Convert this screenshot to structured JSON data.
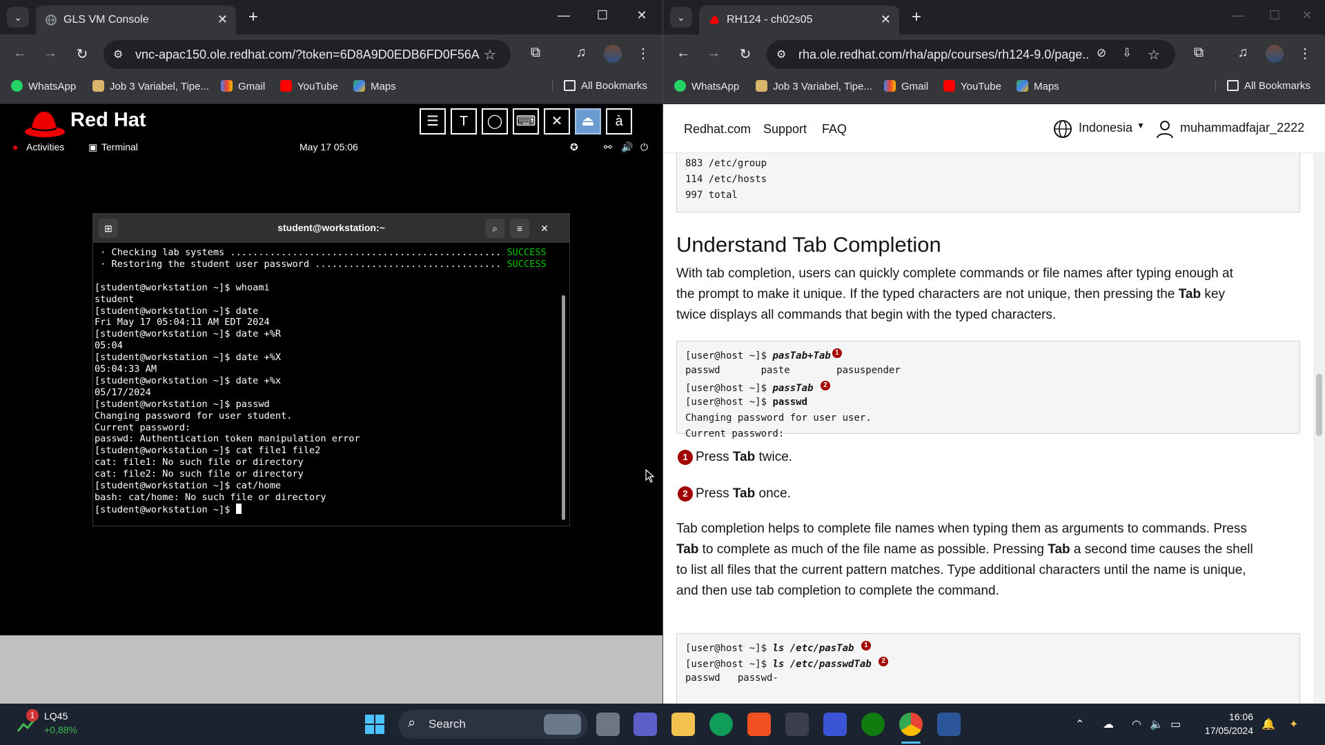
{
  "left_browser": {
    "tab_title": "GLS VM Console",
    "url": "vnc-apac150.ole.redhat.com/?token=6D8A9D0EDB6FD0F56AF...",
    "bookmarks": [
      "WhatsApp",
      "Job 3 Variabel, Tipe...",
      "Gmail",
      "YouTube",
      "Maps"
    ],
    "all_bookmarks": "All Bookmarks"
  },
  "vnc": {
    "brand": "Red Hat",
    "toolbar_glyphs": [
      "☰",
      "T",
      "◯",
      "⌨",
      "✕",
      "⏏",
      "à"
    ],
    "gnome": {
      "activities": "Activities",
      "terminal": "Terminal",
      "clock": "May 17  05:06"
    },
    "terminal": {
      "title": "student@workstation:~",
      "lines": [
        " · Checking lab systems ................................................ ",
        " · Restoring the student user password ................................. ",
        "",
        "[student@workstation ~]$ whoami",
        "student",
        "[student@workstation ~]$ date",
        "Fri May 17 05:04:11 AM EDT 2024",
        "[student@workstation ~]$ date +%R",
        "05:04",
        "[student@workstation ~]$ date +%X",
        "05:04:33 AM",
        "[student@workstation ~]$ date +%x",
        "05/17/2024",
        "[student@workstation ~]$ passwd",
        "Changing password for user student.",
        "Current password:",
        "passwd: Authentication token manipulation error",
        "[student@workstation ~]$ cat file1 file2",
        "cat: file1: No such file or directory",
        "cat: file2: No such file or directory",
        "[student@workstation ~]$ cat/home",
        "bash: cat/home: No such file or directory",
        "[student@workstation ~]$ "
      ],
      "status_ok": "SUCCESS"
    }
  },
  "right_browser": {
    "tab_title": "RH124 - ch02s05",
    "url": "rha.ole.redhat.com/rha/app/courses/rh124-9.0/page...",
    "bookmarks": [
      "WhatsApp",
      "Job 3 Variabel, Tipe...",
      "Gmail",
      "YouTube",
      "Maps"
    ],
    "all_bookmarks": "All Bookmarks"
  },
  "site_nav": {
    "links": [
      "Redhat.com",
      "Support",
      "FAQ"
    ],
    "language": "Indonesia",
    "username": "muhammadfajar_2222"
  },
  "content": {
    "top_code": [
      "883 /etc/group",
      "114 /etc/hosts",
      "997 total"
    ],
    "heading": "Understand Tab Completion",
    "intro": [
      "With tab completion, users can quickly complete commands or file names after typing enough at",
      "the prompt to make it unique. If the typed characters are not unique, then pressing the ",
      "Tab",
      " key",
      "twice displays all commands that begin with the typed characters."
    ],
    "code1": {
      "prompt": "[user@host ~]$ ",
      "l1_cmd": "pasTab+Tab",
      "l2": "passwd       paste        pasuspender",
      "l3_cmd": "passTab",
      "l4_cmd": "passwd",
      "l5": "Changing password for user user.",
      "l6": "Current password:"
    },
    "callouts": [
      "1",
      "2"
    ],
    "notes": [
      {
        "pre": "Press ",
        "key": "Tab",
        "post": " twice."
      },
      {
        "pre": "Press ",
        "key": "Tab",
        "post": " once."
      }
    ],
    "para2": {
      "l1": "Tab completion helps to complete file names when typing them as arguments to commands. Press",
      "l2_key": "Tab",
      "l2_rest": " to complete as much of the file name as possible. Pressing ",
      "l2_key2": "Tab",
      "l2_end": " a second time causes the shell",
      "l3": "to list all files that the current pattern matches. Type additional characters until the name is unique,",
      "l4": "and then use tab completion to complete the command."
    },
    "code2": {
      "prompt": "[user@host ~]$ ",
      "l1_cmd": "ls /etc/pasTab",
      "l2_cmd": "ls /etc/passwdTab",
      "l3": "passwd   passwd-"
    }
  },
  "taskbar": {
    "stock_name": "LQ45",
    "stock_change": "+0,88%",
    "stock_badge": "1",
    "search": "Search",
    "time": "16:06",
    "date": "17/05/2024"
  },
  "colors": {
    "redhat_red": "#ee0000",
    "callout_red": "#a30000",
    "term_success": "#00c800"
  }
}
